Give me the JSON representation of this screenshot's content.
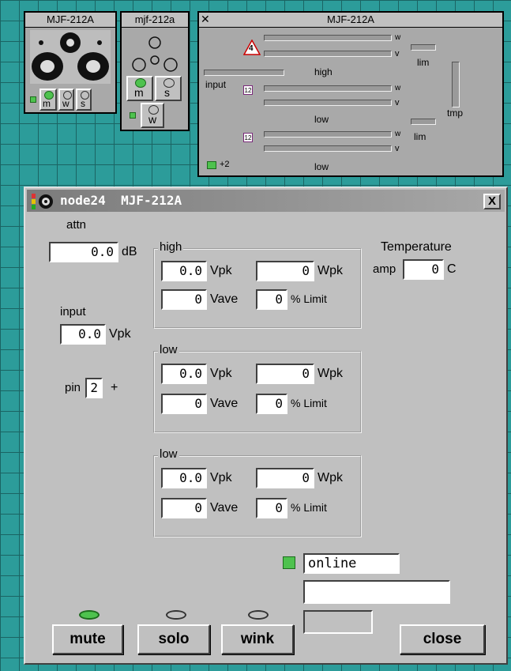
{
  "panels": {
    "speaker1_title": "MJF-212A",
    "speaker2_title": "mjf-212a",
    "meter_title": "MJF-212A",
    "m_label": "m",
    "w_label": "w",
    "s_label": "s",
    "meter": {
      "input_label": "input",
      "high_label": "high",
      "low1_label": "low",
      "low2_label": "low",
      "w_label": "w",
      "v_label": "v",
      "lim_label": "lim",
      "tmp_label": "tmp",
      "chip_label": "12",
      "warn_label": "4",
      "pin_label": "+2"
    }
  },
  "window": {
    "title": "node24  MJF-212A",
    "close_label": "X",
    "attn": {
      "label": "attn",
      "value": "0.0",
      "unit": "dB"
    },
    "input": {
      "label": "input",
      "value": "0.0",
      "unit": "Vpk"
    },
    "pin": {
      "label": "pin",
      "value": "2",
      "suffix": "+"
    },
    "temperature": {
      "label": "Temperature",
      "amp_label": "amp",
      "value": "0",
      "unit": "C"
    },
    "groups": [
      {
        "title": "high",
        "vpk": "0.0",
        "wpk": "0",
        "vave": "0",
        "limit": "0"
      },
      {
        "title": "low",
        "vpk": "0.0",
        "wpk": "0",
        "vave": "0",
        "limit": "0"
      },
      {
        "title": "low",
        "vpk": "0.0",
        "wpk": "0",
        "vave": "0",
        "limit": "0"
      }
    ],
    "units": {
      "vpk": "Vpk",
      "wpk": "Wpk",
      "vave": "Vave",
      "limit": "% Limit"
    },
    "status": {
      "text": "online",
      "field2": "",
      "field3": ""
    },
    "buttons": {
      "mute": "mute",
      "solo": "solo",
      "wink": "wink",
      "close": "close"
    },
    "colors": {
      "online_led": "#4ec24e",
      "mute_led": "#4ec24e"
    }
  }
}
